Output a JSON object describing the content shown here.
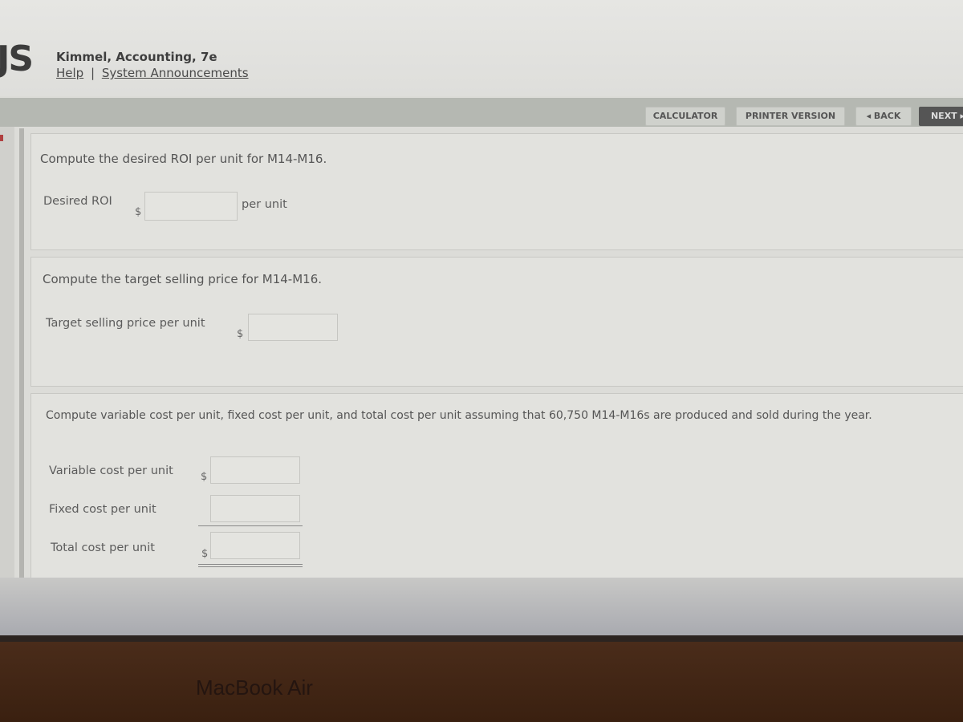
{
  "header": {
    "logo_text": "JS",
    "book_title": "Kimmel, Accounting, 7e",
    "links": {
      "help": "Help",
      "separator": "|",
      "announcements": "System Announcements"
    }
  },
  "toolbar": {
    "calculator": "CALCULATOR",
    "printer_version": "PRINTER VERSION",
    "back": "◂ BACK",
    "next": "NEXT ▸"
  },
  "section_roi": {
    "prompt": "Compute the desired ROI per unit for M14-M16.",
    "label": "Desired ROI",
    "currency": "$",
    "value": "",
    "suffix": "per unit"
  },
  "section_target_price": {
    "prompt": "Compute the target selling price for M14-M16.",
    "label": "Target selling price per unit",
    "currency": "$",
    "value": ""
  },
  "section_costs": {
    "prompt": "Compute variable cost per unit, fixed cost per unit, and total cost per unit assuming that 60,750 M14-M16s are produced and sold during the year.",
    "rows": [
      {
        "label": "Variable cost per unit",
        "currency": "$",
        "value": ""
      },
      {
        "label": "Fixed cost per unit",
        "currency": "",
        "value": ""
      },
      {
        "label": "Total cost per unit",
        "currency": "$",
        "value": ""
      }
    ]
  },
  "device": {
    "bezel_label": "MacBook Air"
  }
}
